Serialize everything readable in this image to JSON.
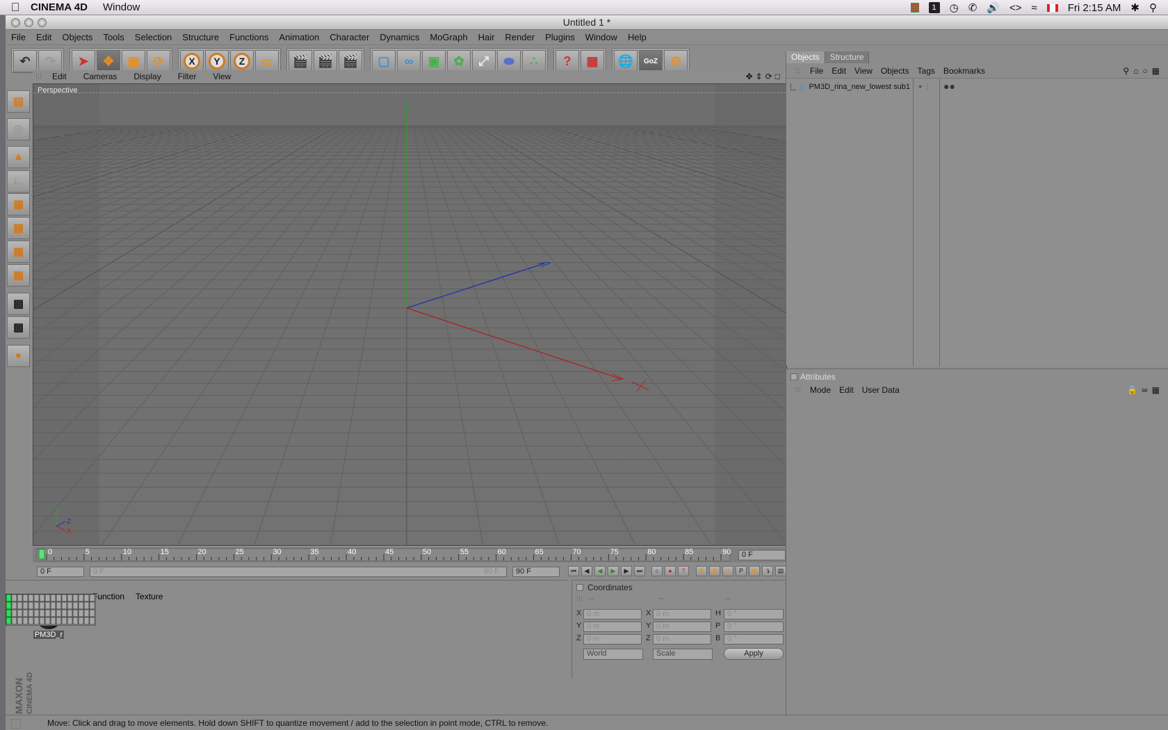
{
  "mac_menubar": {
    "app_name": "CINEMA 4D",
    "menu": "Window",
    "clock": "Fri 2:15 AM"
  },
  "window": {
    "title": "Untitled 1 *"
  },
  "menubar": [
    "File",
    "Edit",
    "Objects",
    "Tools",
    "Selection",
    "Structure",
    "Functions",
    "Animation",
    "Character",
    "Dynamics",
    "MoGraph",
    "Hair",
    "Render",
    "Plugins",
    "Window",
    "Help"
  ],
  "toolbar": {
    "axis_x": "X",
    "axis_y": "Y",
    "axis_z": "Z",
    "goz": "GoZ"
  },
  "viewport": {
    "menu": [
      "Edit",
      "Cameras",
      "Display",
      "Filter",
      "View"
    ],
    "label": "Perspective",
    "axis_y": "Y",
    "axis_z": "Z",
    "axis_x": "X"
  },
  "timeline": {
    "ticks": [
      "0",
      "5",
      "10",
      "15",
      "20",
      "25",
      "30",
      "35",
      "40",
      "45",
      "50",
      "55",
      "60",
      "65",
      "70",
      "75",
      "80",
      "85",
      "90"
    ],
    "current_frame": "0 F",
    "start_frame": "0 F",
    "range_start": "0 F",
    "range_end": "90 F",
    "end_frame": "90 F"
  },
  "material_panel": {
    "menu": [
      "Function",
      "Texture"
    ],
    "material_name": "PM3D_r"
  },
  "coordinates": {
    "title": "Coordinates",
    "col_headers": [
      "--",
      "--",
      "--"
    ],
    "pos": [
      {
        "label": "X",
        "value": "0 m"
      },
      {
        "label": "Y",
        "value": "0 m"
      },
      {
        "label": "Z",
        "value": "0 m"
      }
    ],
    "size": [
      {
        "label": "X",
        "value": "0 m"
      },
      {
        "label": "Y",
        "value": "0 m"
      },
      {
        "label": "Z",
        "value": "0 m"
      }
    ],
    "rot": [
      {
        "label": "H",
        "value": "0 °"
      },
      {
        "label": "P",
        "value": "0 °"
      },
      {
        "label": "B",
        "value": "0 °"
      }
    ],
    "mode_world": "World",
    "mode_scale": "Scale",
    "apply": "Apply"
  },
  "objects_panel": {
    "tabs": [
      "Objects",
      "Structure"
    ],
    "menu": [
      "File",
      "Edit",
      "View",
      "Objects",
      "Tags",
      "Bookmarks"
    ],
    "object_name": "PM3D_rina_new_lowest sub1"
  },
  "attributes_panel": {
    "title": "Attributes",
    "menu": [
      "Mode",
      "Edit",
      "User Data"
    ]
  },
  "status": {
    "text": "Move: Click and drag to move elements. Hold down SHIFT to quantize movement / add to the selection in point mode, CTRL to remove."
  },
  "colors": {
    "accent": "#d07a20",
    "viewport_bg": "#6f6f6f",
    "panel_bg": "#8c8c8c",
    "axis_x": "#b02020",
    "axis_y": "#2ca02c",
    "axis_z": "#2030b0"
  }
}
